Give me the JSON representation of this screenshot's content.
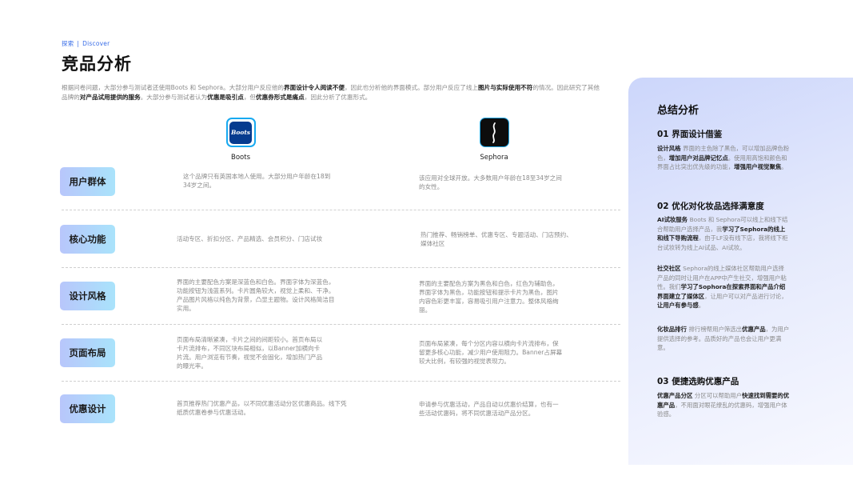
{
  "breadcrumb": {
    "cn": "探索",
    "sep": "|",
    "en": "Discover"
  },
  "title": "竞品分析",
  "intro": [
    {
      "t": "根据问卷问题，大部分参与测试者还使用Boots 和 Sephora。大部分用户反应他的",
      "b": false
    },
    {
      "t": "界面设计令人阅读不便",
      "b": true
    },
    {
      "t": "，因此也分析他的界面模式。部分用户反应了线上",
      "b": false
    },
    {
      "t": "图片与实际使用不符",
      "b": true
    },
    {
      "t": "的情况。因此研究了其他品牌的",
      "b": false
    },
    {
      "t": "对产品试用提供的服务",
      "b": true
    },
    {
      "t": "。大部分参与测试者认为",
      "b": false
    },
    {
      "t": "优惠是吸引点",
      "b": true
    },
    {
      "t": "，但",
      "b": false
    },
    {
      "t": "优惠券形式是痛点",
      "b": true
    },
    {
      "t": "，因此分析了优惠形式。",
      "b": false
    }
  ],
  "brands": {
    "boots": {
      "name": "Boots",
      "logo_text": "Boots",
      "icon": "boots-logo-icon"
    },
    "sephora": {
      "name": "Sephora",
      "icon": "sephora-logo-icon"
    }
  },
  "rows": [
    {
      "label": "用户群体",
      "boots": [
        "这个品牌只有英国本地人使用。大部分用户年龄在18到",
        "34岁之间。"
      ],
      "sephora": [
        "该应用对全球开放。大多数用户年龄在18至34岁之间",
        "的女性。"
      ]
    },
    {
      "label": "核心功能",
      "boots": [
        "活动专区、折扣分区、产品精选、会员积分、门店试妆"
      ],
      "sephora": [
        "热门推荐、畅销榜单、优惠专区、专题活动、门店预约、",
        "媒体社区"
      ]
    },
    {
      "label": "设计风格",
      "boots": [
        "界面的主要配色方案是深蓝色和白色。界面字体为深蓝色，",
        "功能按钮为浅蓝系列。卡片圆角较大，视觉上柔和、干净。",
        "产品图片风格以纯色为背景，凸显主题物。设计风格简洁目",
        "实用。"
      ],
      "sephora": [
        "界面的主要配色方案为黑色和白色，红色为辅助色，",
        "界面字体为黑色，功能按钮和提示卡片为黑色，图片",
        "内容色彩更丰富，容易吸引用户注意力。整体风格绚",
        "丽。"
      ]
    },
    {
      "label": "页面布局",
      "boots": [
        "页面布局清晰紧凑，卡片之间的间距较小。首页布局以",
        "卡片流排布，不同区块布局相似，以Banner加横向卡",
        "片流。用户浏览有节奏，视觉不会固化，增加热门产品",
        "的曝光率。"
      ],
      "sephora": [
        "页面布局紧凑，每个分区内容以横向卡片流排布，保",
        "留更多核心功能，减少用户使用阻力。Banner占屏幕",
        "较大比例，有较强的视觉表现力。"
      ]
    },
    {
      "label": "优惠设计",
      "boots": [
        "首页推荐热门优惠产品，以不同优惠活动分区优惠商品。线下凭",
        "纸质优惠卷参与优惠活动。"
      ],
      "sephora": [
        "申请参与优惠活动，产品自动以优惠价结算，也有一",
        "些活动优惠码，将不同优惠活动产品分区。"
      ]
    }
  ],
  "summary": {
    "title": "总结分析",
    "sections": [
      {
        "heading": "01 界面设计借鉴",
        "paras": [
          [
            {
              "t": "设计风格 ",
              "b": true
            },
            {
              "t": "界面的主色除了黑色，可以增加品牌色粉色，",
              "b": false
            },
            {
              "t": "增加用户对品牌记忆点",
              "b": true
            },
            {
              "t": "。使用用高饱和颜色和界面占比突出优先级的功能，",
              "b": false
            },
            {
              "t": "增强用户视觉聚焦",
              "b": true
            },
            {
              "t": "。",
              "b": false
            }
          ]
        ]
      },
      {
        "heading": "02 优化对化妆品选择满意度",
        "paras": [
          [
            {
              "t": "AI试妆服务 ",
              "b": true
            },
            {
              "t": "Boots 和 Sephora可以线上和线下结合帮助用户选择产品，我",
              "b": false
            },
            {
              "t": "学习了Sephora的线上和线下导购流程",
              "b": true
            },
            {
              "t": "，由于LF没有线下店，我将线下柜台试妆转为线上AI试品、AI试妆。",
              "b": false
            }
          ],
          [
            {
              "t": "社交社区 ",
              "b": true
            },
            {
              "t": "Sephora的线上媒体社区帮助用户选择产品的同时让用户在APP中产生社交，增强用户粘性。我们",
              "b": false
            },
            {
              "t": "学习了Sophora在探索界面和产品介绍界面建立了媒体区",
              "b": true
            },
            {
              "t": "，让用户可以对产品进行讨论，",
              "b": false
            },
            {
              "t": "让用户有参与感",
              "b": true
            },
            {
              "t": "。",
              "b": false
            }
          ],
          [
            {
              "t": "化妆品排行 ",
              "b": true
            },
            {
              "t": "排行榜帮用户筛选出",
              "b": false
            },
            {
              "t": "优惠产品",
              "b": true
            },
            {
              "t": "，为用户提供选择的参考。品质好的产品也会让用户更满意。",
              "b": false
            }
          ]
        ]
      },
      {
        "heading": "03 便捷选购优惠产品",
        "paras": [
          [
            {
              "t": "优惠产品分区 ",
              "b": true
            },
            {
              "t": "分区可以帮助用户",
              "b": false
            },
            {
              "t": "快速找到需要的优惠产品",
              "b": true
            },
            {
              "t": "，不用面对眼花缭乱的优惠码，增强用户体验感。",
              "b": false
            }
          ]
        ]
      }
    ]
  }
}
